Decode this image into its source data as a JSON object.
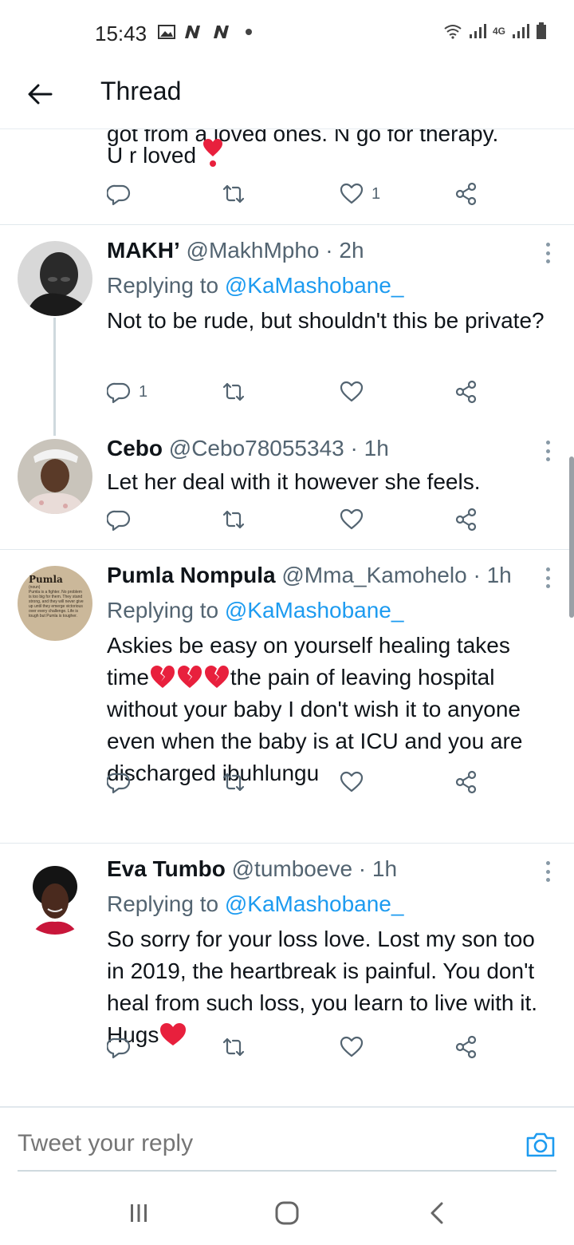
{
  "status_bar": {
    "time": "15:43",
    "network": "4G"
  },
  "header": {
    "title": "Thread"
  },
  "previous_tweet": {
    "cut_off_line": "got from a loved ones. N go for therapy.",
    "last_line": "U r loved",
    "likes": "1"
  },
  "tweets": [
    {
      "name": "MAKH’",
      "handle": "@MakhMpho",
      "time": "· 2h",
      "replying_label": "Replying to",
      "replying_handle": "@KaMashobane_",
      "text": "Not to be rude, but shouldn't this be private?",
      "replies": "1",
      "likes": ""
    },
    {
      "name": "Cebo",
      "handle": "@Cebo78055343",
      "time": "· 1h",
      "text": "Let her deal with it however she feels.",
      "replies": "",
      "likes": ""
    },
    {
      "name": "Pumla Nompula",
      "handle": "@Mma_Kamohelo",
      "time": "· 1h",
      "replying_label": "Replying to",
      "replying_handle": "@KaMashobane_",
      "text_line1": "Askies be easy on yourself healing takes",
      "text_time": "time",
      "text_rest1": "the pain of leaving hospital",
      "text_rest2": "without your baby I don't wish it to anyone even when the baby is at ICU and you are discharged ibuhlungu",
      "avatar_title": "Pumla",
      "avatar_sub": "(noun)",
      "avatar_text": "Pumla is a fighter. No problem is too big for them. They stand strong, and they will never give up until they emerge victorious over every challenge. Life is tough but Pumla is tougher."
    },
    {
      "name": "Eva Tumbo",
      "handle": "@tumboeve",
      "time": "· 1h",
      "replying_label": "Replying to",
      "replying_handle": "@KaMashobane_",
      "text": "So sorry for your loss love. Lost my son too in 2019, the heartbreak is painful. You don't heal from such loss, you learn to live with it. Hugs"
    }
  ],
  "composer": {
    "placeholder": "Tweet your reply"
  },
  "colors": {
    "accent": "#1d9bf0",
    "text": "#0f1419",
    "muted": "#536471",
    "heart": "#e0245e",
    "broken_heart": "#e8203d"
  },
  "icons": [
    "back-arrow-icon",
    "reply-icon",
    "retweet-icon",
    "like-icon",
    "share-icon",
    "more-icon",
    "camera-icon"
  ]
}
